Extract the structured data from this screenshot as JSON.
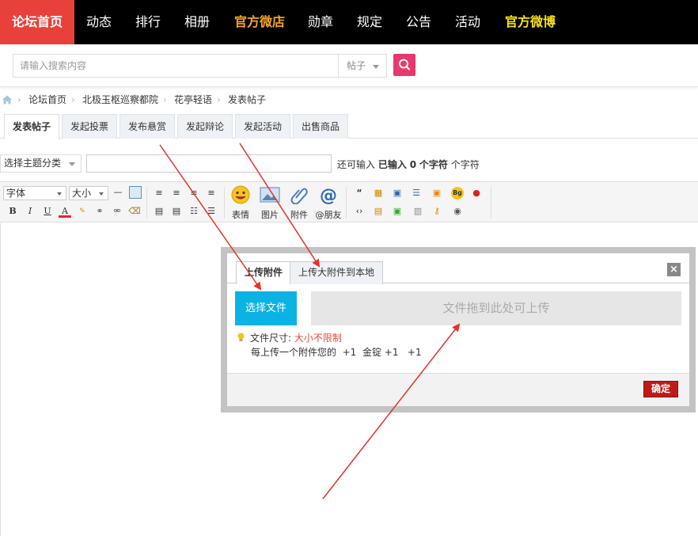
{
  "topnav": {
    "home": "论坛首页",
    "items": [
      {
        "label": "动态"
      },
      {
        "label": "排行"
      },
      {
        "label": "相册"
      },
      {
        "label": "官方微店"
      },
      {
        "label": "勋章"
      },
      {
        "label": "规定"
      },
      {
        "label": "公告"
      },
      {
        "label": "活动"
      },
      {
        "label": "官方微博"
      }
    ],
    "colors": {
      "bar": "#000000",
      "home": "#e8413a",
      "shop": "#f5a623",
      "weibo": "#f8e11a"
    }
  },
  "search": {
    "placeholder": "请输入搜索内容",
    "type": "帖子",
    "button_icon": "search-icon",
    "button_color": "#e8386d"
  },
  "breadcrumb": [
    "论坛首页",
    "北极玉枢巡察都院",
    "花亭轻语",
    "发表帖子"
  ],
  "tabs": [
    "发表帖子",
    "发起投票",
    "发布悬赏",
    "发起辩论",
    "发起活动",
    "出售商品"
  ],
  "post": {
    "topic_select": "选择主题分类",
    "hint_prefix": "还可输入",
    "hint_entered": "已输入",
    "hint_count": "0",
    "hint_unit": "个字符",
    "hint_suffix": "个字符"
  },
  "toolbar": {
    "font": "字体",
    "size": "大小",
    "big_buttons": [
      {
        "label": "表情",
        "icon": "smiley-icon"
      },
      {
        "label": "图片",
        "icon": "image-icon"
      },
      {
        "label": "附件",
        "icon": "paperclip-icon"
      },
      {
        "label": "@朋友",
        "icon": "at-icon"
      }
    ]
  },
  "dialog": {
    "tab_upload": "上传附件",
    "tab_big_upload": "上传大附件到本地",
    "close": "×",
    "choose_file": "选择文件",
    "drop_zone": "文件拖到此处可上传",
    "size_label": "文件尺寸:",
    "size_limit": "大小不限制",
    "reward": "每上传一个附件您的  +1  金锭 +1   +1",
    "ok": "确定",
    "accent": "#0ab3e3"
  }
}
